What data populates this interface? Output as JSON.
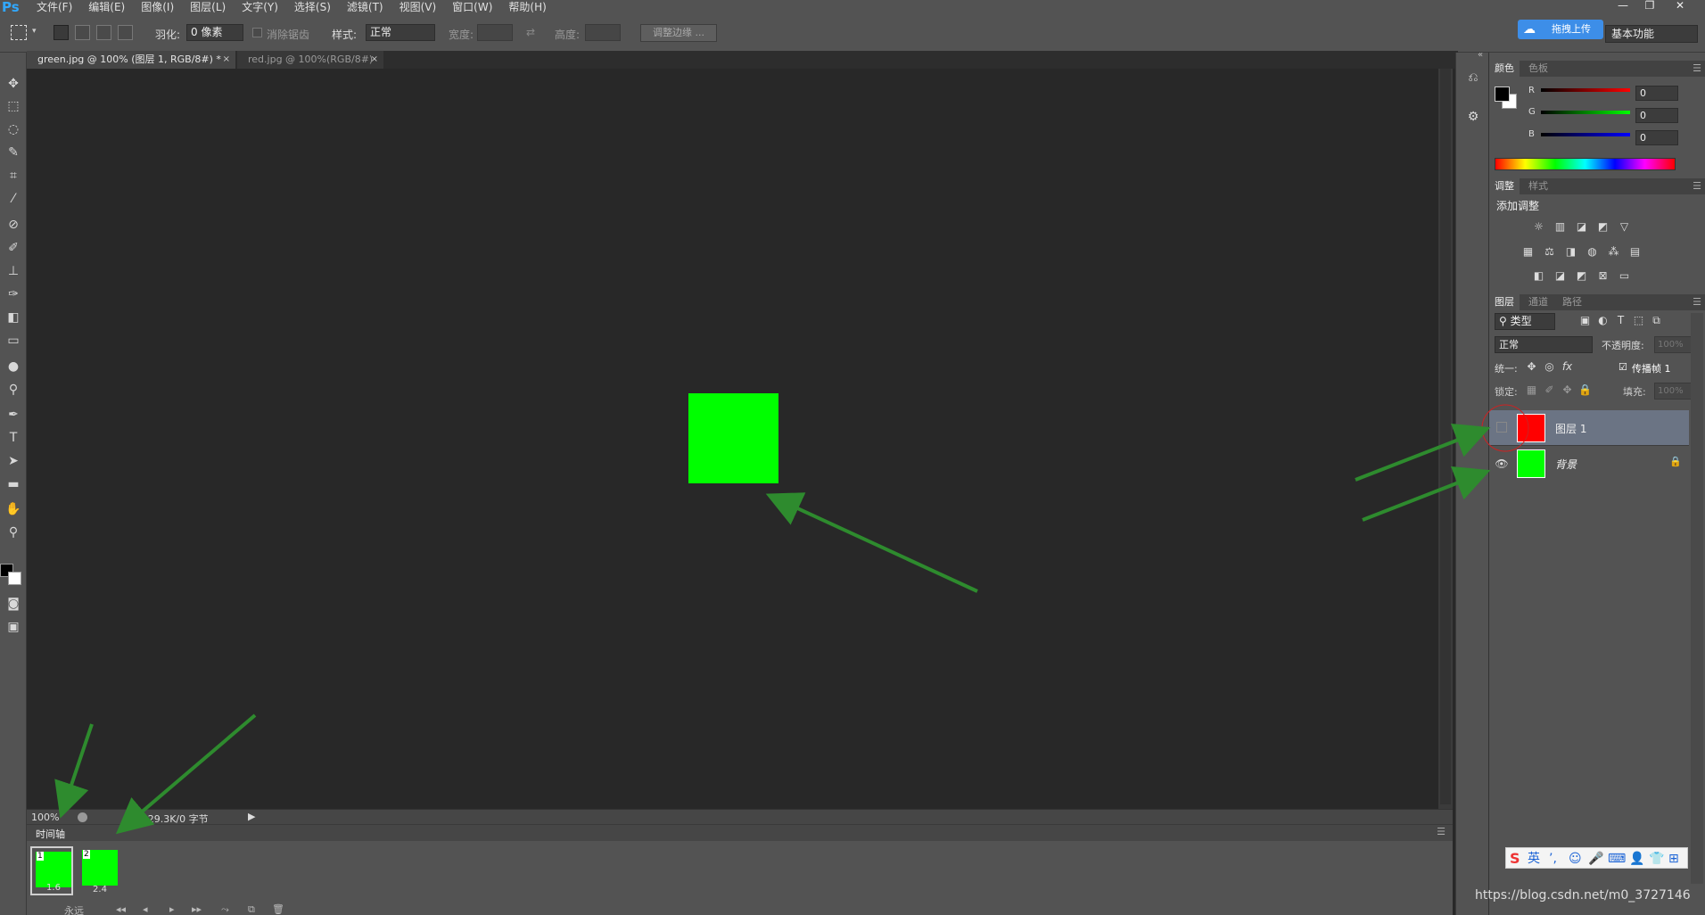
{
  "menubar": {
    "logo": "Ps",
    "items": [
      "文件(F)",
      "编辑(E)",
      "图像(I)",
      "图层(L)",
      "文字(Y)",
      "选择(S)",
      "滤镜(T)",
      "视图(V)",
      "窗口(W)",
      "帮助(H)"
    ],
    "window_controls": [
      "—",
      "❐",
      "✕"
    ]
  },
  "options": {
    "feather_label": "羽化:",
    "feather_value": "0 像素",
    "antialias_label": "消除锯齿",
    "style_label": "样式:",
    "style_value": "正常",
    "width_label": "宽度:",
    "height_label": "高度:",
    "refine_button": "调整边缘 ...",
    "upload_button": "拖拽上传",
    "workspace_value": "基本功能"
  },
  "tabs": [
    {
      "label": "green.jpg @ 100% (图层 1, RGB/8#) *",
      "close": "×"
    },
    {
      "label": "red.jpg @ 100%(RGB/8#)",
      "close": "×"
    }
  ],
  "status": {
    "zoom": "100%",
    "doc_info": "文档:29.3K/0 字节"
  },
  "timeline": {
    "title": "时间轴",
    "loop_value": "永远",
    "frames": [
      {
        "number": "1",
        "delay": "1.6"
      },
      {
        "number": "2",
        "delay": "2.4"
      }
    ]
  },
  "color_panel": {
    "tabs": [
      "颜色",
      "色板"
    ],
    "channels": [
      {
        "label": "R",
        "value": "0",
        "color": "#ff0000"
      },
      {
        "label": "G",
        "value": "0",
        "color": "#00ff00"
      },
      {
        "label": "B",
        "value": "0",
        "color": "#0000ff"
      }
    ]
  },
  "adjust_panel": {
    "tabs": [
      "调整",
      "样式"
    ],
    "title": "添加调整"
  },
  "layers_panel": {
    "tabs": [
      "图层",
      "通道",
      "路径"
    ],
    "filter_value": "类型",
    "blend_mode": "正常",
    "opacity_label": "不透明度:",
    "opacity_value": "100%",
    "unify_label": "统一:",
    "propagate_label": "传播帧 1",
    "lock_label": "锁定:",
    "fill_label": "填充:",
    "fill_value": "100%",
    "layers": [
      {
        "name": "图层 1",
        "color": "#ff0000"
      },
      {
        "name": "背景",
        "color": "#00ff00"
      }
    ]
  },
  "ime": {
    "items": [
      "S",
      "英",
      "’,",
      "☺",
      "🎤",
      "⌨",
      "👤",
      "👕",
      "⊞"
    ]
  },
  "watermark": "https://blog.csdn.net/m0_3727146",
  "colors": {
    "canvas_fill": "#00ff00",
    "layer1": "#ff0000",
    "annotation_arrow": "#2e8b2e"
  }
}
